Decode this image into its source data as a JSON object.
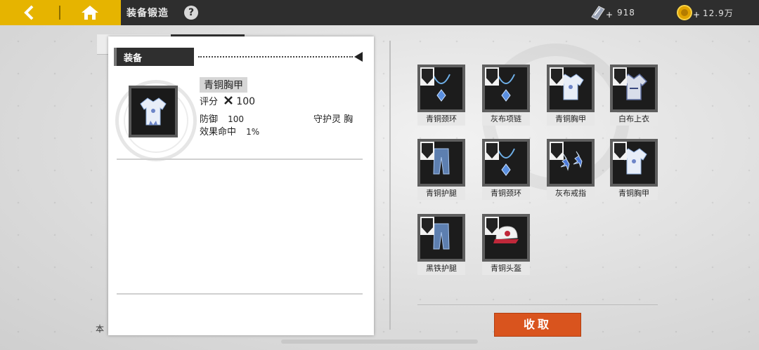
{
  "header": {
    "title": "装备锻造",
    "help_label": "?",
    "resources": [
      {
        "icon": "forge-stone-icon",
        "value": "918"
      },
      {
        "icon": "gold-coin-icon",
        "value": "12.9万"
      }
    ]
  },
  "panel": {
    "section_title": "装备",
    "item": {
      "name": "青铜胸甲",
      "score_label": "评分",
      "score_value": "100",
      "stats": [
        {
          "label": "防御",
          "value": "100"
        },
        {
          "label": "效果命中",
          "value": "1%"
        }
      ],
      "slot_type": "守护灵 胸"
    },
    "cut_text": "本"
  },
  "inventory": {
    "items": [
      {
        "name": "青铜颈环",
        "icon": "necklace-icon"
      },
      {
        "name": "灰布项链",
        "icon": "necklace-icon"
      },
      {
        "name": "青铜胸甲",
        "icon": "chest-armor-icon"
      },
      {
        "name": "白布上衣",
        "icon": "shirt-icon"
      },
      {
        "name": "青铜护腿",
        "icon": "leg-armor-icon"
      },
      {
        "name": "青铜颈环",
        "icon": "necklace-icon"
      },
      {
        "name": "灰布戒指",
        "icon": "ring-icon"
      },
      {
        "name": "青铜胸甲",
        "icon": "chest-armor-icon"
      },
      {
        "name": "黑铁护腿",
        "icon": "leg-armor-icon"
      },
      {
        "name": "青铜头盔",
        "icon": "helmet-icon"
      }
    ]
  },
  "collect_button": "收取",
  "colors": {
    "accent": "#e6b400",
    "button": "#d9541e"
  }
}
